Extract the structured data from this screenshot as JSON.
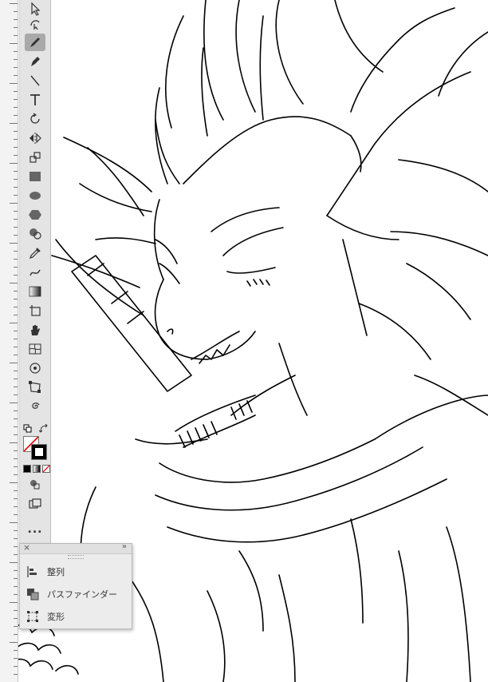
{
  "app": {
    "accent_color": "#a9a9a9",
    "stroke_color": "#000000"
  },
  "toolbar": {
    "tools": [
      {
        "id": "selection",
        "icon": "selection-arrow-icon",
        "active": false
      },
      {
        "id": "curvature",
        "icon": "curvature-icon",
        "active": false
      },
      {
        "id": "pencil",
        "icon": "pencil-icon",
        "active": true
      },
      {
        "id": "pen",
        "icon": "pen-icon",
        "active": false
      },
      {
        "id": "line",
        "icon": "line-segment-icon",
        "active": false
      },
      {
        "id": "type",
        "icon": "type-icon",
        "active": false
      },
      {
        "id": "rotate",
        "icon": "rotate-icon",
        "active": false
      },
      {
        "id": "reflect",
        "icon": "reflect-icon",
        "active": false
      },
      {
        "id": "scale",
        "icon": "scale-icon",
        "active": false
      },
      {
        "id": "rectangle",
        "icon": "rectangle-icon",
        "active": false
      },
      {
        "id": "ellipse",
        "icon": "ellipse-icon",
        "active": false
      },
      {
        "id": "polygon",
        "icon": "polygon-icon",
        "active": false
      },
      {
        "id": "shape-builder",
        "icon": "shape-builder-icon",
        "active": false
      },
      {
        "id": "eyedropper",
        "icon": "eyedropper-icon",
        "active": false
      },
      {
        "id": "blend",
        "icon": "blend-icon",
        "active": false
      },
      {
        "id": "gradient",
        "icon": "gradient-icon",
        "active": false
      },
      {
        "id": "artboard",
        "icon": "artboard-icon",
        "active": false
      },
      {
        "id": "hand",
        "icon": "hand-icon",
        "active": false
      },
      {
        "id": "mesh",
        "icon": "mesh-icon",
        "active": false
      },
      {
        "id": "puppet",
        "icon": "puppet-warp-icon",
        "active": false
      },
      {
        "id": "free-transform",
        "icon": "free-transform-icon",
        "active": false
      },
      {
        "id": "spiral",
        "icon": "spiral-icon",
        "active": false
      }
    ],
    "fill_stroke": {
      "fill": "none",
      "stroke": "#000000"
    },
    "more_label": "..."
  },
  "panel": {
    "items": [
      {
        "label": "整列",
        "icon": "align-icon"
      },
      {
        "label": "パスファインダー",
        "icon": "pathfinder-icon"
      },
      {
        "label": "変形",
        "icon": "transform-icon"
      }
    ]
  }
}
